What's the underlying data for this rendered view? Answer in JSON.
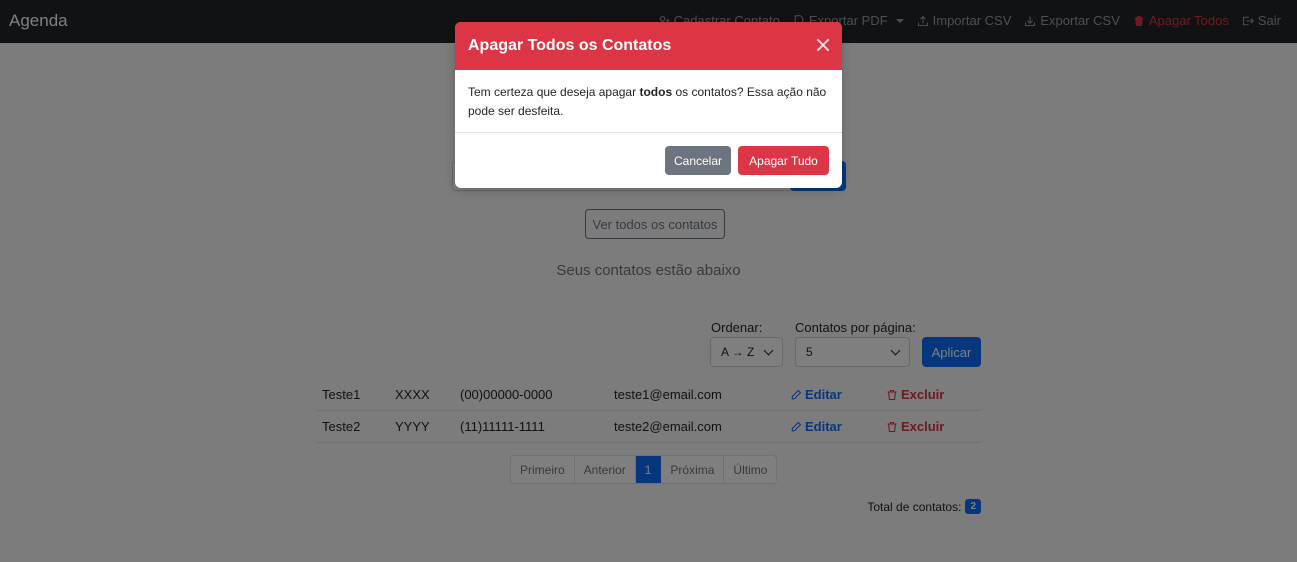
{
  "navbar": {
    "brand": "Agenda",
    "items": [
      {
        "label": "Cadastrar Contato",
        "icon": "person-plus-icon"
      },
      {
        "label": "Exportar PDF",
        "icon": "file-pdf-icon"
      },
      {
        "label": "Importar CSV",
        "icon": "upload-icon"
      },
      {
        "label": "Exportar CSV",
        "icon": "download-icon"
      },
      {
        "label": "Apagar Todos",
        "icon": "trash-icon"
      },
      {
        "label": "Sair",
        "icon": "logout-icon"
      }
    ]
  },
  "main": {
    "view_all_label": "Ver todos os contatos",
    "subtitle": "Seus contatos estão abaixo",
    "sort": {
      "label": "Ordenar:",
      "value": "A → Z"
    },
    "per_page": {
      "label": "Contatos por página:",
      "value": "5"
    },
    "apply_label": "Aplicar",
    "edit_label": "Editar",
    "delete_label": "Excluir",
    "contacts": [
      {
        "name": "Teste1",
        "code": "XXXX",
        "phone": "(00)00000-0000",
        "email": "teste1@email.com"
      },
      {
        "name": "Teste2",
        "code": "YYYY",
        "phone": "(11)11111-1111",
        "email": "teste2@email.com"
      }
    ],
    "pagination": [
      "Primeiro",
      "Anterior",
      "1",
      "Próxima",
      "Último"
    ],
    "total_label": "Total de contatos:",
    "total_count": "2"
  },
  "modal": {
    "title": "Apagar Todos os Contatos",
    "body_prefix": "Tem certeza que deseja apagar ",
    "body_bold": "todos",
    "body_suffix": " os contatos? Essa ação não pode ser desfeita.",
    "cancel_label": "Cancelar",
    "confirm_label": "Apagar Tudo"
  },
  "colors": {
    "danger": "#dc3545",
    "primary": "#0d6efd",
    "secondary": "#6c757d",
    "navbar": "#212529"
  }
}
